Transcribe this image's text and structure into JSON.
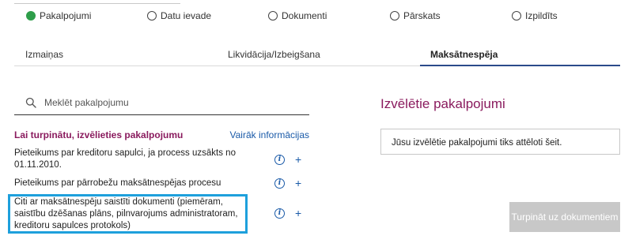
{
  "stepper": {
    "steps": [
      {
        "label": "Pakalpojumi",
        "active": true
      },
      {
        "label": "Datu ievade",
        "active": false
      },
      {
        "label": "Dokumenti",
        "active": false
      },
      {
        "label": "Pārskats",
        "active": false
      },
      {
        "label": "Izpildīts",
        "active": false
      }
    ]
  },
  "tabs": [
    {
      "label": "Izmaiņas",
      "active": false
    },
    {
      "label": "Likvidācija/Izbeigšana",
      "active": false
    },
    {
      "label": "Maksātnespēja",
      "active": true
    }
  ],
  "search": {
    "placeholder": "Meklēt pakalpojumu",
    "value": ""
  },
  "services": {
    "title": "Lai turpinātu, izvēlieties pakalpojumu",
    "more_info": "Vairāk informācijas",
    "items": [
      {
        "label": "Pieteikums par kreditoru sapulci, ja process uzsākts no 01.11.2010."
      },
      {
        "label": "Pieteikums par pārrobežu maksātnespējas procesu"
      },
      {
        "label": "Citi ar maksātnespēju saistīti dokumenti (piemēram, saistību dzēšanas plāns, pilnvarojums administratoram, kreditoru sapulces protokols)"
      }
    ],
    "info_glyph": "i",
    "add_glyph": "+"
  },
  "right_panel": {
    "title": "Izvēlētie pakalpojumi",
    "placeholder_text": "Jūsu izvēlētie pakalpojumi tiks attēloti šeit.",
    "continue_label": "Turpināt uz dokumentiem"
  },
  "colors": {
    "active_step": "#2e9e4a",
    "accent_purple": "#8a1b5e",
    "link_blue": "#1a5aa8",
    "highlight": "#1ea0dc",
    "disabled_button": "#c8c8c8"
  }
}
